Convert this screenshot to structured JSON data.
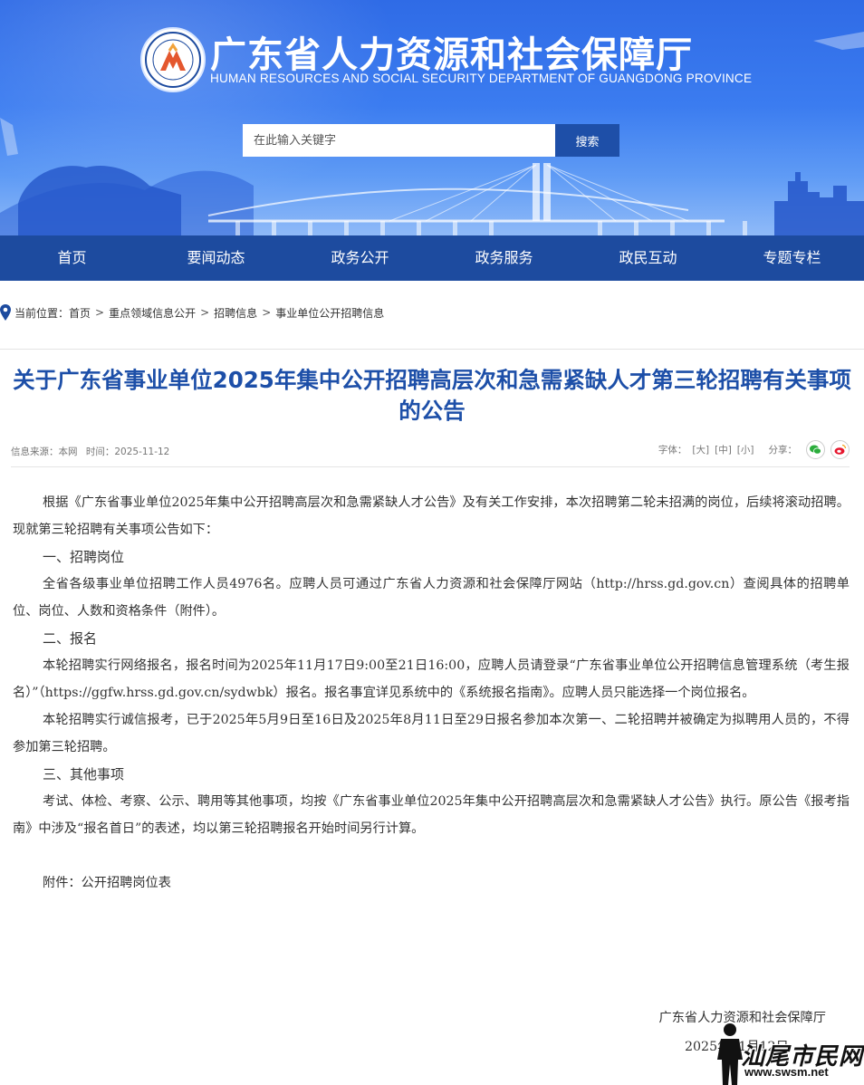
{
  "header": {
    "title": "广东省人力资源和社会保障厅",
    "subtitle": "HUMAN RESOURCES AND SOCIAL SECURITY DEPARTMENT OF GUANGDONG PROVINCE",
    "search_placeholder": "在此输入关键字",
    "search_button": "搜索",
    "colors": {
      "banner": "#3b7cf0",
      "nav": "#1d4b9f",
      "search_button": "#1e4fa8"
    }
  },
  "nav": {
    "items": [
      {
        "label": "首页"
      },
      {
        "label": "要闻动态"
      },
      {
        "label": "政务公开"
      },
      {
        "label": "政务服务"
      },
      {
        "label": "政民互动"
      },
      {
        "label": "专题专栏"
      }
    ]
  },
  "breadcrumb": {
    "prefix": "当前位置：",
    "items": [
      "首页",
      "重点领域信息公开",
      "招聘信息",
      "事业单位公开招聘信息"
    ],
    "separator": ">"
  },
  "article": {
    "title": "关于广东省事业单位2025年集中公开招聘高层次和急需紧缺人才第三轮招聘有关事项的公告",
    "source": "信息来源：本网",
    "time": "时间：2025-11-12",
    "font_label": "字体：",
    "font_sizes": [
      "[大]",
      "[中]",
      "[小]"
    ],
    "share_label": "分享：",
    "share_icons": [
      "wechat-icon",
      "weibo-icon"
    ],
    "intro": "根据《广东省事业单位2025年集中公开招聘高层次和急需紧缺人才公告》及有关工作安排，本次招聘第二轮未招满的岗位，后续将滚动招聘。现就第三轮招聘有关事项公告如下：",
    "section1_heading": "一、招聘岗位",
    "section1_text": "全省各级事业单位招聘工作人员4976名。应聘人员可通过广东省人力资源和社会保障厅网站（http://hrss.gd.gov.cn）查阅具体的招聘单位、岗位、人数和资格条件（附件）。",
    "section2_heading": "二、报名",
    "section2_text1": "本轮招聘实行网络报名，报名时间为2025年11月17日9:00至21日16:00，应聘人员请登录“广东省事业单位公开招聘信息管理系统（考生报名）”（https://ggfw.hrss.gd.gov.cn/sydwbk）报名。报名事宜详见系统中的《系统报名指南》。应聘人员只能选择一个岗位报名。",
    "section2_text2": "本轮招聘实行诚信报考，已于2025年5月9日至16日及2025年8月11日至29日报名参加本次第一、二轮招聘并被确定为拟聘用人员的，不得参加第三轮招聘。",
    "section3_heading": "三、其他事项",
    "section3_text": "考试、体检、考察、公示、聘用等其他事项，均按《广东省事业单位2025年集中公开招聘高层次和急需紧缺人才公告》执行。原公告《报考指南》中涉及“报名首日”的表述，均以第三轮招聘报名开始时间另行计算。",
    "attachment": "附件：公开招聘岗位表",
    "sign_org": "广东省人力资源和社会保障厅",
    "sign_date": "2025年11月12日"
  },
  "watermark": {
    "text": "汕尾市民网",
    "url": "www.swsm.net"
  }
}
